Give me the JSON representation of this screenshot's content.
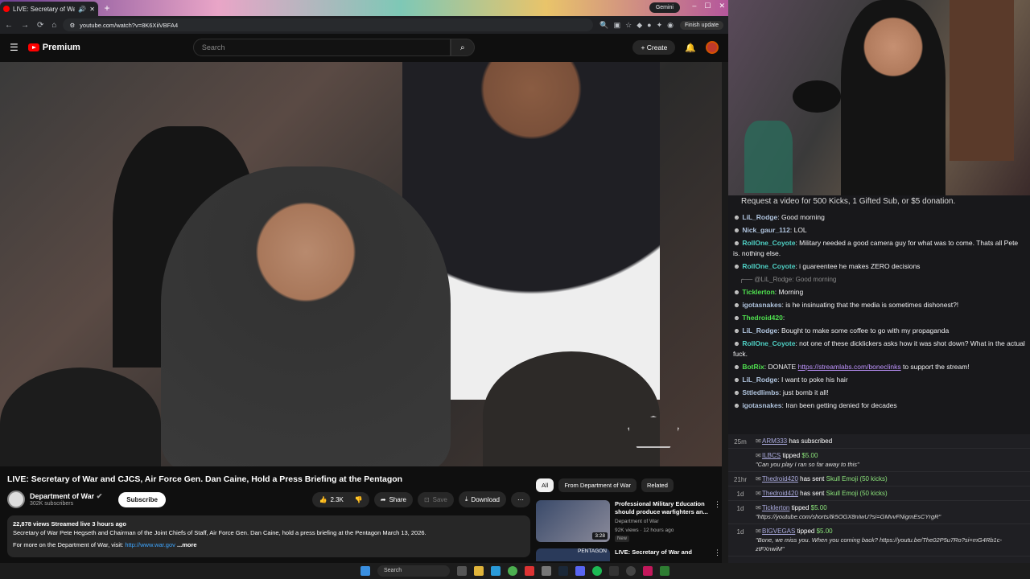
{
  "browser": {
    "tab_title": "LIVE: Secretary of War and",
    "gemini_label": "Gemini",
    "url": "youtube.com/watch?v=8K6XiiVBFA4",
    "finish_update": "Finish update"
  },
  "youtube": {
    "brand": "Premium",
    "search_placeholder": "Search",
    "create_label": "Create",
    "video": {
      "title": "LIVE: Secretary of War and CJCS, Air Force Gen. Dan Caine, Hold a Press Briefing at the Pentagon",
      "channel": "Department of War",
      "subscribers": "302K subscribers",
      "subscribe_label": "Subscribe",
      "likes": "2.3K",
      "share_label": "Share",
      "save_label": "Save",
      "download_label": "Download",
      "description": {
        "meta": "22,878 views  Streamed live 3 hours ago",
        "line1": "Secretary of War Pete Hegseth and Chairman of the Joint Chiefs of Staff, Air Force Gen. Dan Caine, hold a press briefing at the Pentagon March 13, 2026.",
        "line2_prefix": "For more on the Department of War, visit: ",
        "link": "http://www.war.gov",
        "more": "...more"
      }
    },
    "chips": [
      "All",
      "From Department of War",
      "Related"
    ],
    "recommendations": [
      {
        "title": "Professional Military Education should produce warfighters an...",
        "channel": "Department of War",
        "meta": "92K views · 12 hours ago",
        "badge": "New",
        "duration": "3:28"
      },
      {
        "title": "LIVE: Secretary of War and",
        "thumb_label": "PENTAGON"
      }
    ]
  },
  "stream": {
    "banner": "Request a video for 500 Kicks, 1 Gifted Sub, or $5 donation."
  },
  "chat": [
    {
      "user": "LiL_Rodge",
      "color": "#b0c4de",
      "text": "Good morning"
    },
    {
      "user": "Nick_gaur_112",
      "color": "#b0c4de",
      "text": "LOL"
    },
    {
      "user": "RollOne_Coyote",
      "color": "#4fd1c5",
      "text": "Military needed a good camera guy for what was to come. Thats all Pete is. nothing else."
    },
    {
      "user": "RollOne_Coyote",
      "color": "#4fd1c5",
      "text": "i guareentee he makes ZERO decisions"
    },
    {
      "reply": "@LiL_Rodge: Good morning"
    },
    {
      "user": "Ticklerton",
      "color": "#4fe04f",
      "text": "Morning"
    },
    {
      "user": "igotasnakes",
      "color": "#b0c4de",
      "text": "is he insinuating that the media is sometimes dishonest?!"
    },
    {
      "user": "Thedroid420",
      "color": "#4fe04f",
      "text": ""
    },
    {
      "user": "LiL_Rodge",
      "color": "#b0c4de",
      "text": "Bought to make some coffee to go with my propaganda"
    },
    {
      "user": "RollOne_Coyote",
      "color": "#4fd1c5",
      "text": "not one of these dicklickers asks how it was shot down? What in the actual fuck."
    },
    {
      "user": "BotRix",
      "color": "#4fe04f",
      "text": "DONATE ",
      "link": "https://streamlabs.com/boneclinks",
      "suffix": " to support the stream!"
    },
    {
      "user": "LiL_Rodge",
      "color": "#b0c4de",
      "text": "I want to poke his hair"
    },
    {
      "user": "Sttledlimbs",
      "color": "#b0c4de",
      "text": "just bomb it all!"
    },
    {
      "user": "igotasnakes",
      "color": "#b0c4de",
      "text": "Iran been getting denied for decades"
    }
  ],
  "events": [
    {
      "time": "25m",
      "user": "ARM333",
      "text": " has subscribed"
    },
    {
      "time": "",
      "user": "ILBCS",
      "text": " tipped ",
      "amount": "$5.00",
      "quote": "\"Can you play I ran so far away to this\""
    },
    {
      "time": "21hr",
      "user": "Thedroid420",
      "text": " has sent ",
      "amount": "Skull Emoji (50 kicks)"
    },
    {
      "time": "1d",
      "user": "Thedroid420",
      "text": " has sent ",
      "amount": "Skull Emoji (50 kicks)"
    },
    {
      "time": "1d",
      "user": "Ticklerton",
      "text": " tipped ",
      "amount": "$5.00",
      "quote": "\"https://youtube.com/shorts/tk5OGX8nIwU?si=GMvvFNigmEsCYrgR\""
    },
    {
      "time": "1d",
      "user": "BIGVEGAS",
      "text": " tipped ",
      "amount": "$5.00",
      "quote": "\"Bone, we miss you. When you coming back? https://youtu.be/The02P5u7Ro?si=mG4Rb1c-ztFXnwiM\""
    }
  ],
  "taskbar": {
    "search": "Search"
  }
}
